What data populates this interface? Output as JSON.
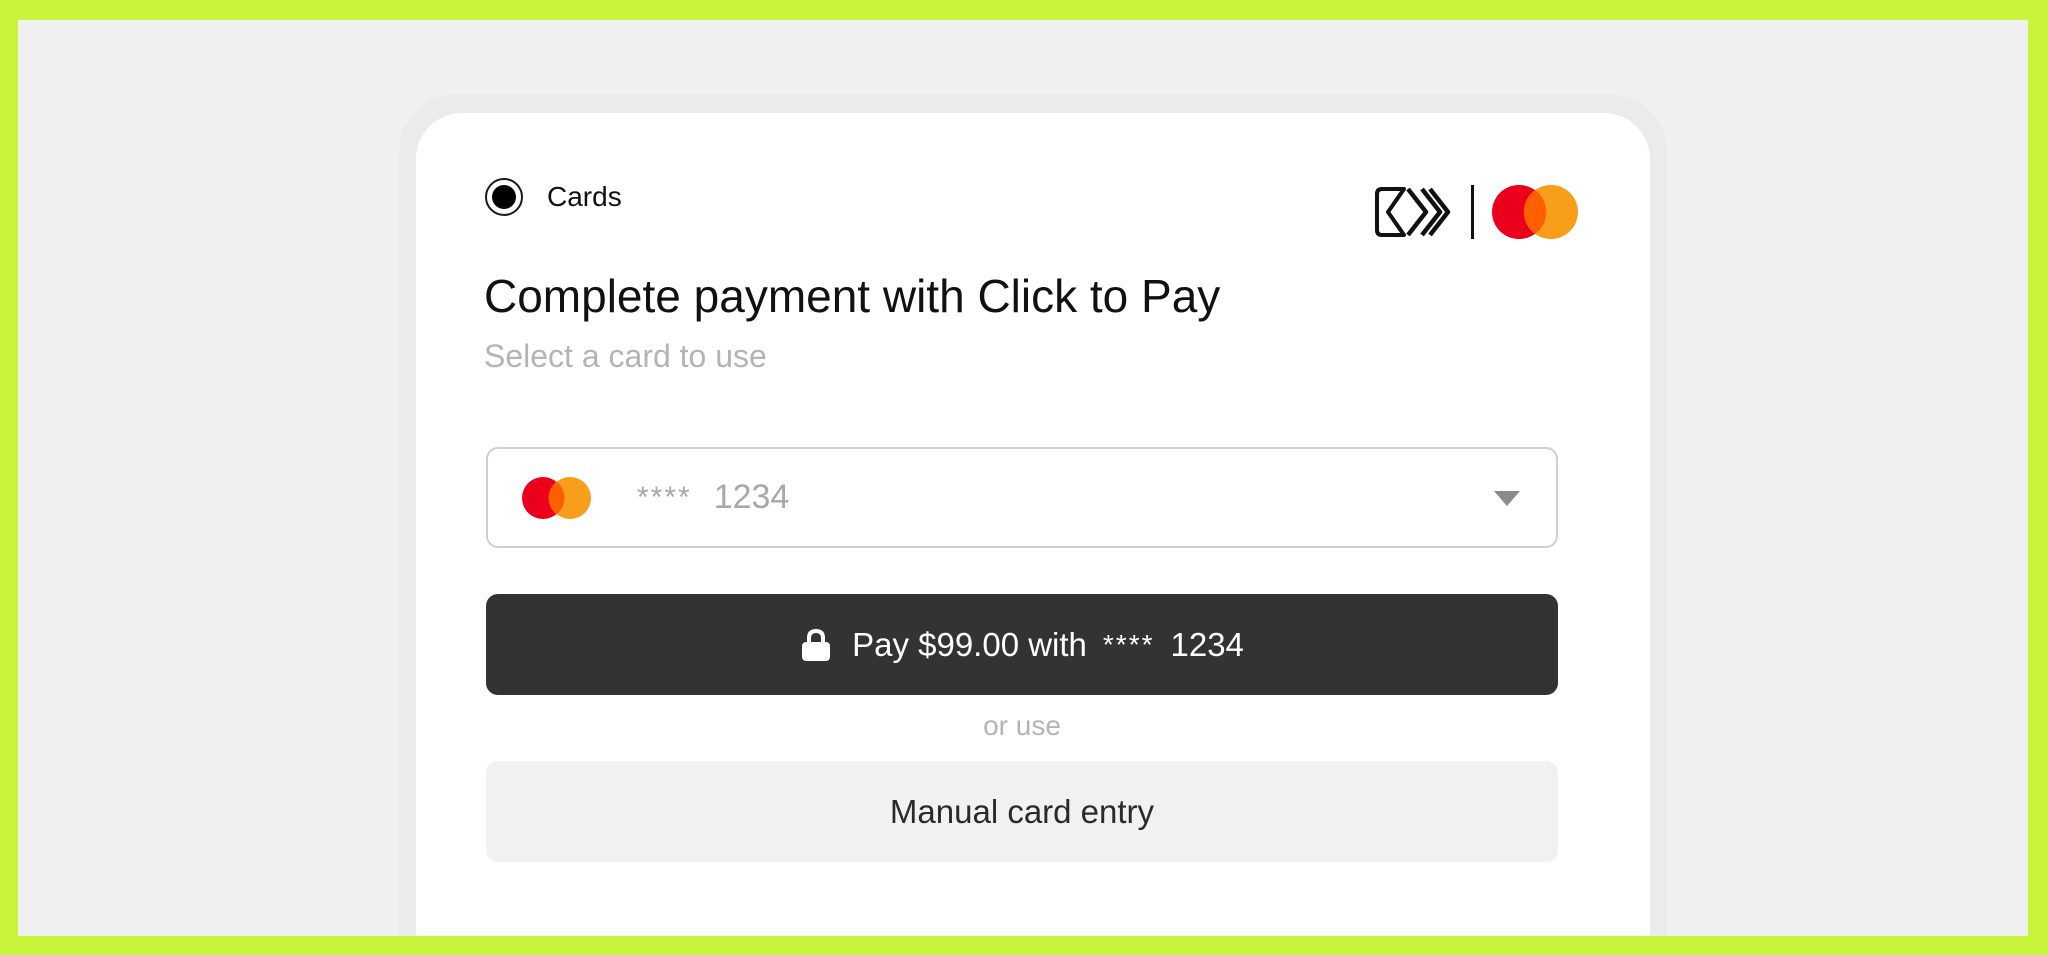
{
  "colors": {
    "frame_border": "#c8f53c",
    "background": "#f0f0f0",
    "card": "#ffffff",
    "pay_button": "#333333",
    "manual_button": "#f1f1f1",
    "mastercard_red": "#eb001b",
    "mastercard_orange": "#f79e1b",
    "mastercard_overlap": "#ff5f00"
  },
  "payment_method": {
    "selected": true,
    "label": "Cards",
    "brand_icons": [
      "click-to-pay-icon",
      "mastercard-icon"
    ]
  },
  "header": {
    "title": "Complete payment with Click to Pay",
    "subtitle": "Select a card to use"
  },
  "card_selector": {
    "brand_icon": "mastercard-icon",
    "masked": "****",
    "last4": "1234",
    "dropdown_icon": "chevron-down-icon"
  },
  "pay_button": {
    "icon": "lock-icon",
    "label": "Pay $99.00 with",
    "masked": "****",
    "last4": "1234"
  },
  "divider_text": "or use",
  "manual_entry": {
    "label": "Manual card entry"
  }
}
